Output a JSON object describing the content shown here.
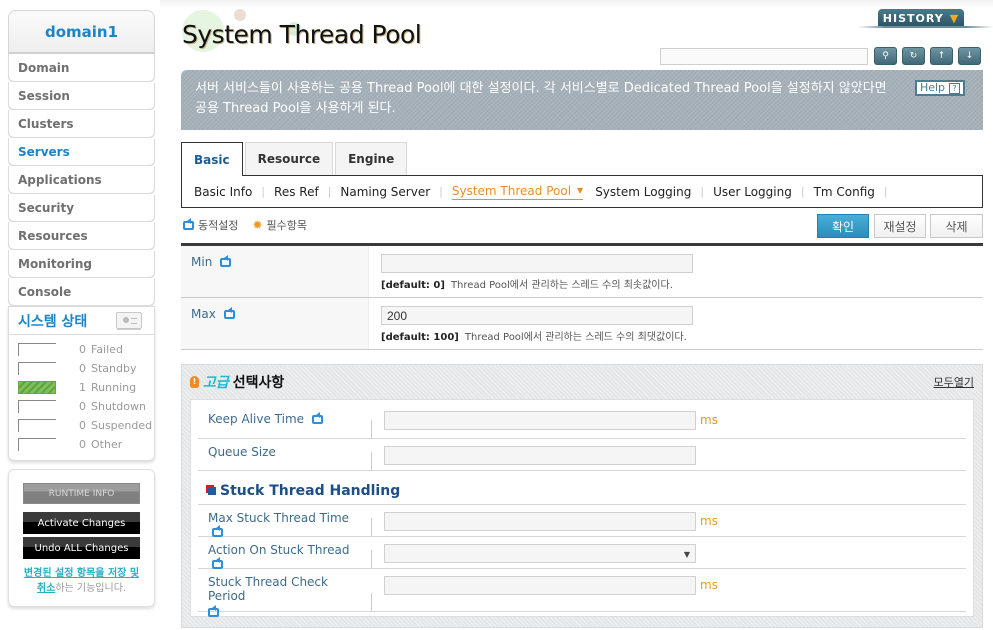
{
  "sidebar": {
    "domain_name": "domain1",
    "nav_items": [
      {
        "label": "Domain",
        "active": false
      },
      {
        "label": "Session",
        "active": false
      },
      {
        "label": "Clusters",
        "active": false
      },
      {
        "label": "Servers",
        "active": true
      },
      {
        "label": "Applications",
        "active": false
      },
      {
        "label": "Security",
        "active": false
      },
      {
        "label": "Resources",
        "active": false
      },
      {
        "label": "Monitoring",
        "active": false
      },
      {
        "label": "Console",
        "active": false
      }
    ],
    "system_status": {
      "title": "시스템 상태",
      "rows": [
        {
          "count": "0",
          "label": "Failed"
        },
        {
          "count": "0",
          "label": "Standby"
        },
        {
          "count": "1",
          "label": "Running"
        },
        {
          "count": "0",
          "label": "Shutdown"
        },
        {
          "count": "0",
          "label": "Suspended"
        },
        {
          "count": "0",
          "label": "Other"
        }
      ]
    },
    "runtime_info_label": "RUNTIME INFO",
    "activate_changes_label": "Activate Changes",
    "undo_changes_label": "Undo ALL Changes",
    "change_note_link": "변경된 설정 항목을 저장 및 취소",
    "change_note_rest": "하는 기능입니다."
  },
  "header": {
    "page_title": "System Thread Pool",
    "history_label": "HISTORY",
    "search_placeholder": "",
    "toolbar_icons": [
      "search-icon",
      "refresh-icon",
      "xml-upload-icon",
      "xml-download-icon"
    ],
    "description": "서버 서비스들이 사용하는 공용 Thread Pool에 대한 설정이다. 각 서비스별로 Dedicated Thread Pool을 설정하지 않았다면 공용 Thread Pool을 사용하게 된다.",
    "help_label": "Help"
  },
  "tabs": [
    {
      "label": "Basic",
      "active": true
    },
    {
      "label": "Resource",
      "active": false
    },
    {
      "label": "Engine",
      "active": false
    }
  ],
  "subnav": [
    {
      "label": "Basic Info",
      "active": false
    },
    {
      "label": "Res Ref",
      "active": false
    },
    {
      "label": "Naming Server",
      "active": false
    },
    {
      "label": "System Thread Pool",
      "active": true
    },
    {
      "label": "System Logging",
      "active": false
    },
    {
      "label": "User Logging",
      "active": false
    },
    {
      "label": "Tm Config",
      "active": false
    }
  ],
  "legend": {
    "dynamic_label": "동적설정",
    "required_label": "필수항목"
  },
  "actions": {
    "confirm_label": "확인",
    "reset_label": "재설정",
    "delete_label": "삭제"
  },
  "basic_fields": [
    {
      "label": "Min",
      "value": "",
      "default": "[default: 0]",
      "description": "Thread Pool에서 관리하는 스레드 수의 최솟값이다."
    },
    {
      "label": "Max",
      "value": "200",
      "default": "[default: 100]",
      "description": "Thread Pool에서 관리하는 스레드 수의 최댓값이다."
    }
  ],
  "advanced": {
    "title_highlight": "고급",
    "title_rest": "선택사항",
    "open_all_label": "모두열기",
    "fields": [
      {
        "label": "Keep Alive Time",
        "value": "",
        "unit": "ms"
      },
      {
        "label": "Queue Size",
        "value": "",
        "unit": ""
      }
    ],
    "stuck_section_title": "Stuck Thread Handling",
    "stuck_fields": [
      {
        "label": "Max Stuck Thread Time",
        "value": "",
        "unit": "ms"
      },
      {
        "label": "Action On Stuck Thread",
        "value": "",
        "unit": ""
      },
      {
        "label": "Stuck Thread Check Period",
        "value": "",
        "unit": "ms"
      }
    ]
  }
}
